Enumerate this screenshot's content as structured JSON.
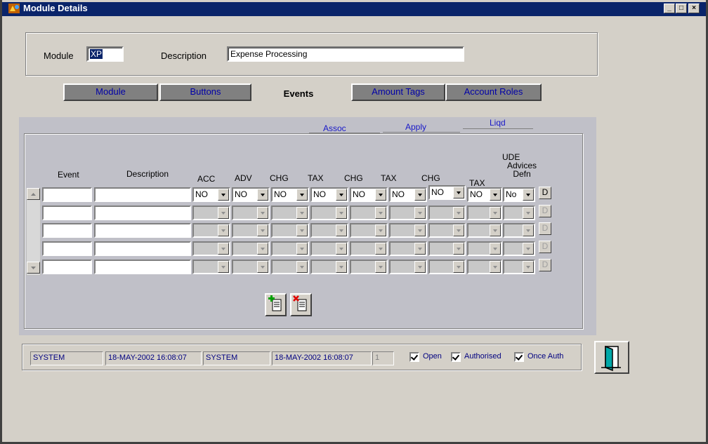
{
  "window": {
    "title": "Module Details",
    "controls": [
      "_",
      "□",
      "×"
    ]
  },
  "header": {
    "module_label": "Module",
    "module_value": "XP",
    "description_label": "Description",
    "description_value": "Expense Processing"
  },
  "tabs": [
    {
      "label": "Module",
      "active": false
    },
    {
      "label": "Buttons",
      "active": false
    },
    {
      "label": "Events",
      "active": true
    },
    {
      "label": "Amount Tags",
      "active": false
    },
    {
      "label": "Account Roles",
      "active": false
    }
  ],
  "events": {
    "group_headers": {
      "assoc": "Assoc",
      "apply": "Apply",
      "liqd": "Liqd"
    },
    "columns": {
      "event": "Event",
      "description": "Description",
      "acc": "ACC",
      "adv": "ADV",
      "chg1": "CHG",
      "tax1": "TAX",
      "chg2": "CHG",
      "tax2": "TAX",
      "chg3": "CHG",
      "tax3": "TAX",
      "ude": "UDE",
      "advices_defn": "Advices Defn"
    },
    "row1": {
      "acc": "NO",
      "adv": "NO",
      "chg1": "NO",
      "tax1": "NO",
      "chg2": "NO",
      "tax2": "NO",
      "chg3": "NO",
      "tax3": "NO",
      "ude": "No"
    },
    "details_button": "D"
  },
  "audit": {
    "maker_id": "SYSTEM",
    "maker_date": "18-MAY-2002 16:08:07",
    "checker_id": "SYSTEM",
    "checker_date": "18-MAY-2002 16:08:07",
    "mod_no": "1",
    "open_label": "Open",
    "authorised_label": "Authorised",
    "once_auth_label": "Once Auth"
  },
  "colors": {
    "titlebar": "#0a246a",
    "tab_inactive": "#808080",
    "tab_text": "#0000a8",
    "panel": "#c0c0c8",
    "window": "#d4d0c8"
  },
  "icons": [
    "module-app-icon",
    "add-row-icon",
    "delete-row-icon",
    "exit-door-icon",
    "checkbox-icon",
    "dropdown-arrow-icon"
  ]
}
